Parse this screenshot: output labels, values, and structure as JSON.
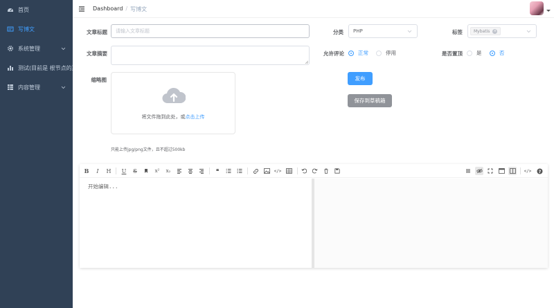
{
  "sidebar": {
    "items": [
      {
        "label": "首页",
        "icon": "dashboard-icon"
      },
      {
        "label": "写博文",
        "icon": "write-icon",
        "active": true
      },
      {
        "label": "系统管理",
        "icon": "gear-icon"
      },
      {
        "label": "测试(目前是 根节点的菜单",
        "icon": "bar-chart-icon"
      },
      {
        "label": "内容管理",
        "icon": "grid-icon"
      }
    ]
  },
  "navbar": {
    "breadcrumb": [
      "Dashboard",
      "写博文"
    ]
  },
  "form": {
    "title_label": "文章标题",
    "title_placeholder": "请输入文章标题",
    "category_label": "分类",
    "category_value": "PHP",
    "tag_label": "标签",
    "tag_value": "Mybatis",
    "summary_label": "文章摘要",
    "comment_label": "允许评论",
    "comment_options": [
      "正常",
      "停用"
    ],
    "top_label": "是否置顶",
    "top_options": [
      "是",
      "否"
    ],
    "thumb_label": "缩略图",
    "upload_text": "将文件拖到此处，或",
    "upload_link": "点击上传",
    "upload_tip": "只能上传jpg/png文件，且不超过500kb",
    "publish_button": "发布",
    "draft_button": "保存到草稿箱"
  },
  "editor": {
    "placeholder": "开始编辑..."
  },
  "colors": {
    "sidebar_bg": "#304156",
    "accent": "#409EFF",
    "gray_button": "#909399"
  }
}
